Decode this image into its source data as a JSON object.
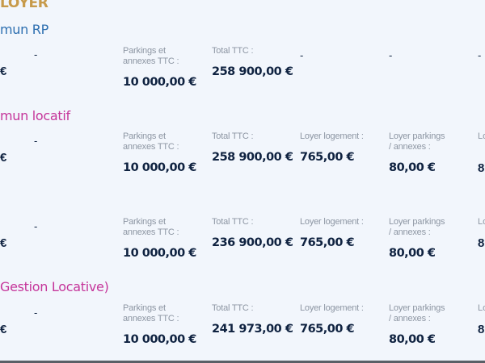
{
  "title": "LOYER",
  "sections": [
    {
      "heading": "mun RP",
      "edge_value": "€",
      "dash": "-",
      "parkings_label": "Parkings et annexes TTC :",
      "parkings_value": "10 000,00 €",
      "total_label": "Total TTC :",
      "total_value": "258 900,00 €",
      "dash_col4": "-",
      "dash_col5": "-",
      "dash_col6": "-"
    },
    {
      "heading": "mun locatif",
      "edge_value": "€",
      "dash": "-",
      "parkings_label": "Parkings et annexes TTC :",
      "parkings_value": "10 000,00 €",
      "total_label": "Total TTC :",
      "total_value": "258 900,00 €",
      "loyer_logement_label": "Loyer logement :",
      "loyer_logement_value": "765,00 €",
      "loyer_parkings_label": "Loyer parkings / annexes :",
      "loyer_parkings_value": "80,00 €",
      "edge_label": "Lo",
      "edge_right_value": "8"
    },
    {
      "heading": "",
      "edge_value": "€",
      "dash": "-",
      "parkings_label": "Parkings et annexes TTC :",
      "parkings_value": "10 000,00 €",
      "total_label": "Total TTC :",
      "total_value": "236 900,00 €",
      "loyer_logement_label": "Loyer logement :",
      "loyer_logement_value": "765,00 €",
      "loyer_parkings_label": "Loyer parkings / annexes :",
      "loyer_parkings_value": "80,00 €",
      "edge_label": "Lo",
      "edge_right_value": "8"
    },
    {
      "heading": "Gestion Locative)",
      "edge_value": "€",
      "dash": "-",
      "parkings_label": "Parkings et annexes TTC :",
      "parkings_value": "10 000,00 €",
      "total_label": "Total TTC :",
      "total_value": "241 973,00 €",
      "loyer_logement_label": "Loyer logement :",
      "loyer_logement_value": "765,00 €",
      "loyer_parkings_label": "Loyer parkings / annexes :",
      "loyer_parkings_value": "80,00 €",
      "edge_label": "Lo",
      "edge_right_value": "8"
    }
  ]
}
